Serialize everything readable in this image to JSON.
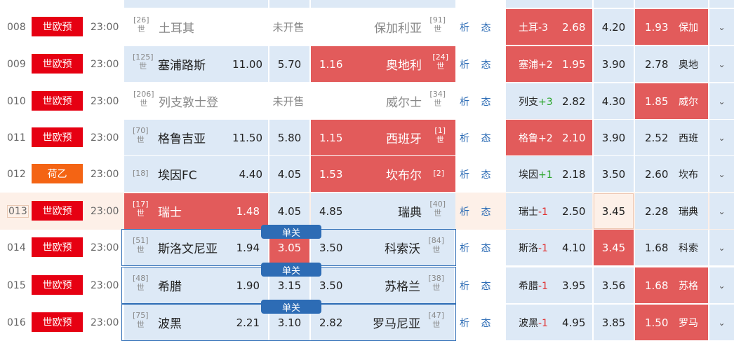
{
  "colors": {
    "accent_red": "#e25b5b",
    "league_red": "#e60012",
    "league_orange": "#f46414",
    "cell_blue": "#dde9f6",
    "link_blue": "#2d6cb5"
  },
  "analysis_label": "析 态",
  "single_label": "单关",
  "rows": [
    {
      "num": "008",
      "league": "世欧预",
      "league_color": "red",
      "time": "23:00",
      "home": "土耳其",
      "home_rank": "[26]",
      "home_sub": "世",
      "away": "保加利亚",
      "away_rank": "[91]",
      "away_sub": "世",
      "not_on_sale": "未开售",
      "h_label": "土耳",
      "h_sign": "-3",
      "h_win": "2.68",
      "h_draw": "4.20",
      "h_lose": "1.93",
      "h_away": "保加"
    },
    {
      "num": "009",
      "league": "世欧预",
      "league_color": "red",
      "time": "23:00",
      "home": "塞浦路斯",
      "home_rank": "[125]",
      "home_sub": "世",
      "away": "奥地利",
      "away_rank": "[24]",
      "away_sub": "世",
      "o_win": "11.00",
      "o_draw": "5.70",
      "o_lose": "1.16",
      "h_label": "塞浦",
      "h_sign": "+2",
      "h_win": "1.95",
      "h_draw": "3.90",
      "h_lose": "2.78",
      "h_away": "奥地"
    },
    {
      "num": "010",
      "league": "世欧预",
      "league_color": "red",
      "time": "23:00",
      "home": "列支敦士登",
      "home_rank": "[206]",
      "home_sub": "世",
      "away": "威尔士",
      "away_rank": "[34]",
      "away_sub": "世",
      "not_on_sale": "未开售",
      "h_label": "列支",
      "h_sign": "+3",
      "h_win": "2.82",
      "h_draw": "4.30",
      "h_lose": "1.85",
      "h_away": "威尔"
    },
    {
      "num": "011",
      "league": "世欧预",
      "league_color": "red",
      "time": "23:00",
      "home": "格鲁吉亚",
      "home_rank": "[70]",
      "home_sub": "世",
      "away": "西班牙",
      "away_rank": "[1]",
      "away_sub": "世",
      "o_win": "11.50",
      "o_draw": "5.80",
      "o_lose": "1.15",
      "h_label": "格鲁",
      "h_sign": "+2",
      "h_win": "2.10",
      "h_draw": "3.90",
      "h_lose": "2.52",
      "h_away": "西班"
    },
    {
      "num": "012",
      "league": "荷乙",
      "league_color": "orange",
      "time": "23:00",
      "home": "埃因FC",
      "home_rank": "[18]",
      "home_sub": "",
      "away": "坎布尔",
      "away_rank": "[2]",
      "away_sub": "",
      "o_win": "4.40",
      "o_draw": "4.05",
      "o_lose": "1.53",
      "h_label": "埃因",
      "h_sign": "+1",
      "h_win": "2.18",
      "h_draw": "3.50",
      "h_lose": "2.60",
      "h_away": "坎布"
    },
    {
      "num": "013",
      "league": "世欧预",
      "league_color": "red",
      "time": "23:00",
      "home": "瑞士",
      "home_rank": "[17]",
      "home_sub": "世",
      "away": "瑞典",
      "away_rank": "[40]",
      "away_sub": "世",
      "o_win": "1.48",
      "o_draw": "4.05",
      "o_lose": "4.85",
      "h_label": "瑞士",
      "h_sign": "-1",
      "h_win": "2.50",
      "h_draw": "3.45",
      "h_lose": "2.28",
      "h_away": "瑞典"
    },
    {
      "num": "014",
      "league": "世欧预",
      "league_color": "red",
      "time": "23:00",
      "home": "斯洛文尼亚",
      "home_rank": "[51]",
      "home_sub": "世",
      "away": "科索沃",
      "away_rank": "[84]",
      "away_sub": "世",
      "o_win": "1.94",
      "o_draw": "3.05",
      "o_lose": "3.50",
      "h_label": "斯洛",
      "h_sign": "-1",
      "h_win": "4.10",
      "h_draw": "3.45",
      "h_lose": "1.68",
      "h_away": "科索"
    },
    {
      "num": "015",
      "league": "世欧预",
      "league_color": "red",
      "time": "23:00",
      "home": "希腊",
      "home_rank": "[48]",
      "home_sub": "世",
      "away": "苏格兰",
      "away_rank": "[38]",
      "away_sub": "世",
      "o_win": "1.90",
      "o_draw": "3.15",
      "o_lose": "3.50",
      "h_label": "希腊",
      "h_sign": "-1",
      "h_win": "3.95",
      "h_draw": "3.56",
      "h_lose": "1.68",
      "h_away": "苏格"
    },
    {
      "num": "016",
      "league": "世欧预",
      "league_color": "red",
      "time": "23:00",
      "home": "波黑",
      "home_rank": "[75]",
      "home_sub": "世",
      "away": "罗马尼亚",
      "away_rank": "[47]",
      "away_sub": "世",
      "o_win": "2.21",
      "o_draw": "3.10",
      "o_lose": "2.82",
      "h_label": "波黑",
      "h_sign": "-1",
      "h_win": "4.95",
      "h_draw": "3.85",
      "h_lose": "1.50",
      "h_away": "罗马"
    }
  ]
}
